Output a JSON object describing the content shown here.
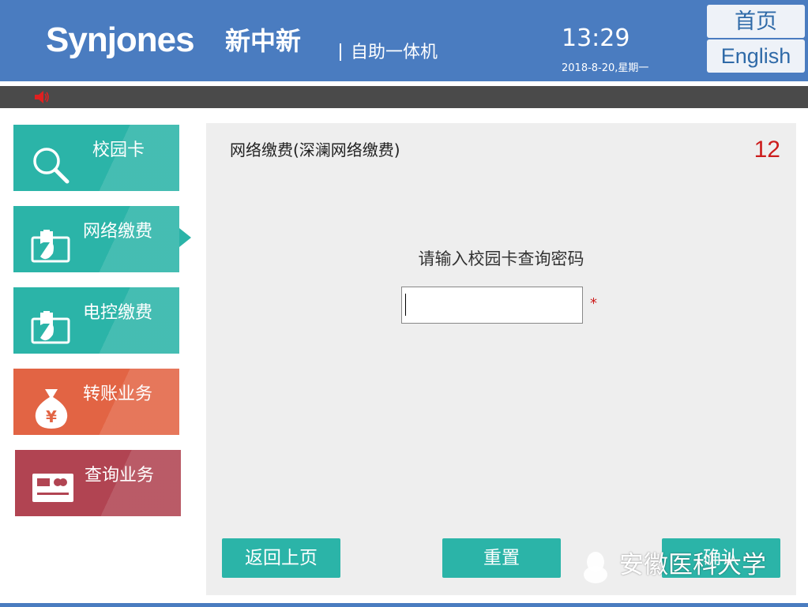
{
  "header": {
    "brand_logo": "Synjones",
    "brand_cn": "新中新",
    "subtitle": "自助一体机",
    "time": "13:29",
    "date": "2018-8-20,星期一",
    "home_button": "首页",
    "english_button": "English"
  },
  "sidebar": {
    "items": [
      {
        "label": "校园卡",
        "icon": "search-icon",
        "color": "#2bb4a8"
      },
      {
        "label": "网络缴费",
        "icon": "hand-card-icon",
        "color": "#2bb4a8"
      },
      {
        "label": "电控缴费",
        "icon": "hand-card-icon",
        "color": "#2bb4a8"
      },
      {
        "label": "转账业务",
        "icon": "money-bag-icon",
        "color": "#e26444"
      },
      {
        "label": "查询业务",
        "icon": "bank-card-icon",
        "color": "#b14452"
      }
    ],
    "active_index": 1
  },
  "main": {
    "title": "网络缴费(深澜网络缴费)",
    "countdown": "12",
    "prompt": "请输入校园卡查询密码",
    "password_value": "",
    "required_mark": "*",
    "buttons": {
      "back": "返回上页",
      "reset": "重置",
      "confirm": "确认"
    }
  },
  "watermark": {
    "text": "安徽医科大学"
  },
  "colors": {
    "header_blue": "#4a7cc0",
    "teal": "#2bb4a8",
    "orange": "#e26444",
    "crimson": "#b14452",
    "countdown_red": "#cc1c1c"
  }
}
